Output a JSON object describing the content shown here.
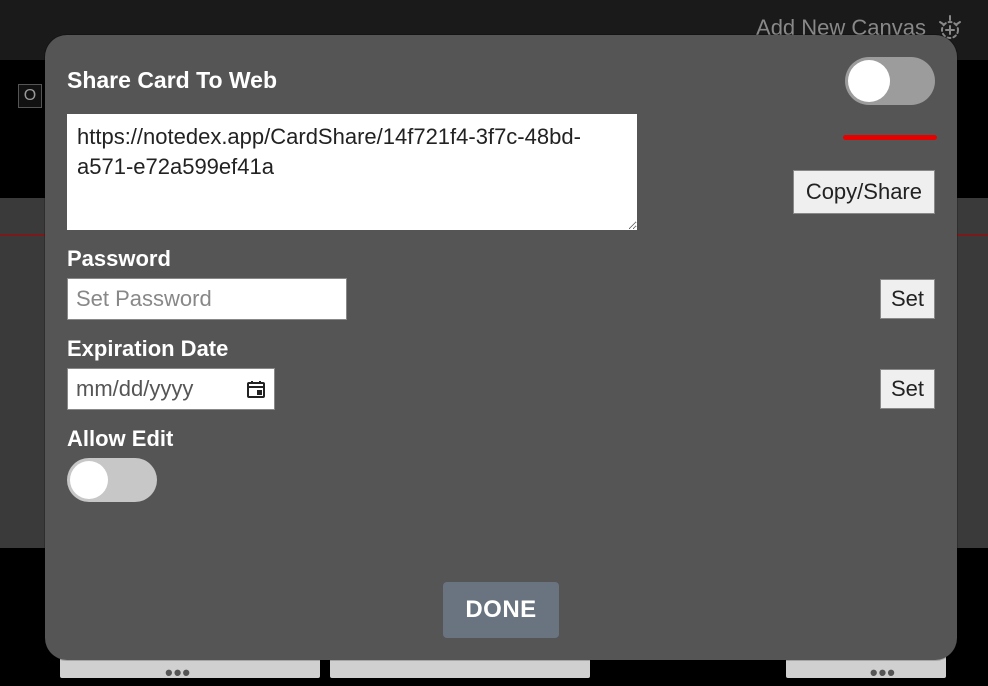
{
  "background": {
    "add_canvas_label": "Add New Canvas",
    "left_square_char": "O"
  },
  "modal": {
    "title": "Share Card To Web",
    "share_toggle_on": false,
    "share_url": "https://notedex.app/CardShare/14f721f4-3f7c-48bd-a571-e72a599ef41a",
    "copy_share_label": "Copy/Share",
    "password_label": "Password",
    "password_placeholder": "Set Password",
    "password_value": "",
    "password_set_label": "Set",
    "expiration_label": "Expiration Date",
    "expiration_placeholder": "mm/dd/yyyy",
    "expiration_value": "",
    "expiration_set_label": "Set",
    "allow_edit_label": "Allow Edit",
    "allow_edit_on": false,
    "done_label": "DONE"
  }
}
